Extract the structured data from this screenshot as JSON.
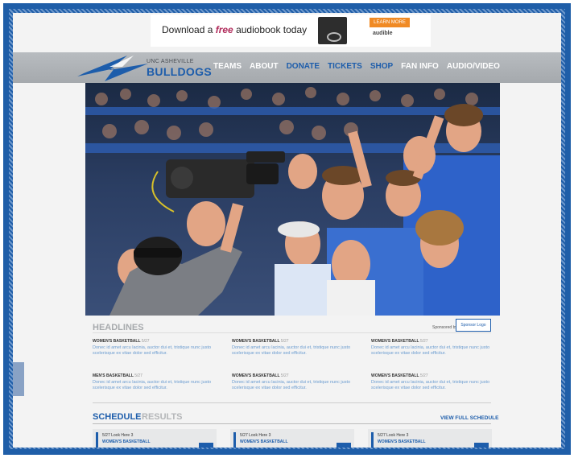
{
  "ad": {
    "text_before": "Download a ",
    "text_free": "free",
    "text_after": " audiobook today",
    "learn_more": "LEARN MORE",
    "brand": "audible"
  },
  "brand": {
    "top_line": "UNC ASHEVILLE",
    "main": "BULLDOGS"
  },
  "nav": {
    "items": [
      {
        "label": "TEAMS",
        "style": "white"
      },
      {
        "label": "ABOUT",
        "style": "white"
      },
      {
        "label": "DONATE",
        "style": "blue"
      },
      {
        "label": "TICKETS",
        "style": "blue"
      },
      {
        "label": "SHOP",
        "style": "blue"
      },
      {
        "label": "FAN INFO",
        "style": "white"
      },
      {
        "label": "AUDIO/VIDEO",
        "style": "white"
      }
    ]
  },
  "headlines": {
    "title": "HEADLINES",
    "sponsored_by": "Sponsored by",
    "sponsor_logo": "Sponsor Logo",
    "items": [
      {
        "category": "WOMEN'S BASKETBALL",
        "date": "5/27",
        "text": "Donec id amet arcu lacinia, auctor dui et, tristique nunc justo scelerisque ex vitae dolor sed efficitur."
      },
      {
        "category": "WOMEN'S BASKETBALL",
        "date": "5/27",
        "text": "Donec id amet arcu lacinia, auctor dui et, tristique nunc justo scelerisque ex vitae dolor sed efficitur."
      },
      {
        "category": "WOMEN'S BASKETBALL",
        "date": "5/27",
        "text": "Donec id amet arcu lacinia, auctor dui et, tristique nunc justo scelerisque ex vitae dolor sed efficitur."
      },
      {
        "category": "MEN'S BASKETBALL",
        "date": "5/27",
        "text": "Donec id amet arcu lacinia, auctor dui et, tristique nunc justo scelerisque ex vitae dolor sed efficitur."
      },
      {
        "category": "WOMEN'S BASKETBALL",
        "date": "5/27",
        "text": "Donec id amet arcu lacinia, auctor dui et, tristique nunc justo scelerisque ex vitae dolor sed efficitur."
      },
      {
        "category": "WOMEN'S BASKETBALL",
        "date": "5/27",
        "text": "Donec id amet arcu lacinia, auctor dui et, tristique nunc justo scelerisque ex vitae dolor sed efficitur."
      }
    ]
  },
  "schedule": {
    "tab_active": "SCHEDULE",
    "tab_inactive": "RESULTS",
    "view_full": "VIEW FULL SCHEDULE",
    "cards": [
      {
        "line1": "5/27  Look Here 3",
        "line2": "WOMEN'S BASKETBALL"
      },
      {
        "line1": "5/27  Look Here 3",
        "line2": "WOMEN'S BASKETBALL"
      },
      {
        "line1": "5/27  Look Here 3",
        "line2": "WOMEN'S BASKETBALL"
      }
    ]
  },
  "colors": {
    "brand_blue": "#1d5dab",
    "nav_gray": "#a9adb1",
    "frame_blue": "#1f5ea8",
    "ad_orange": "#f08a24"
  }
}
